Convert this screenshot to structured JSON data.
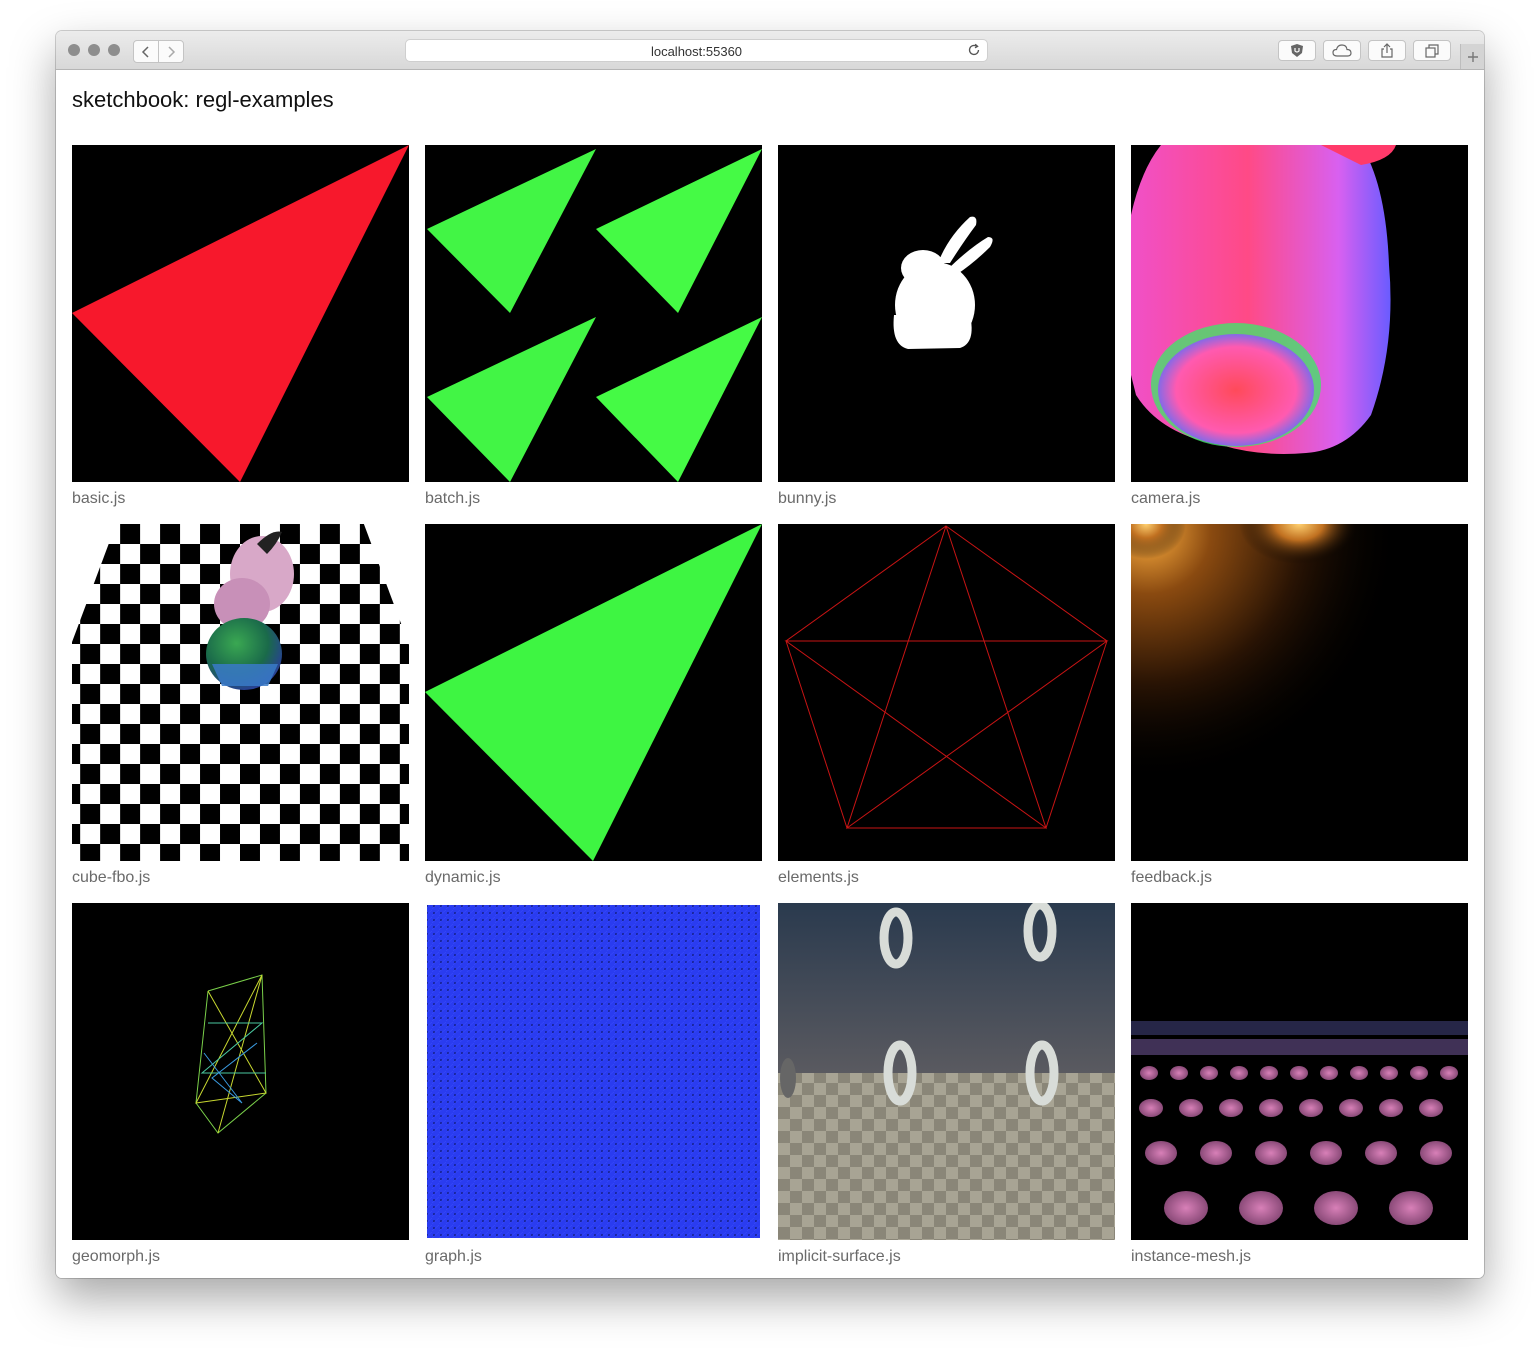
{
  "browser": {
    "url": "localhost:55360"
  },
  "page": {
    "title": "sketchbook: regl-examples"
  },
  "examples": [
    {
      "label": "basic.js"
    },
    {
      "label": "batch.js"
    },
    {
      "label": "bunny.js"
    },
    {
      "label": "camera.js"
    },
    {
      "label": "cube-fbo.js"
    },
    {
      "label": "dynamic.js"
    },
    {
      "label": "elements.js"
    },
    {
      "label": "feedback.js"
    },
    {
      "label": "geomorph.js"
    },
    {
      "label": "graph.js"
    },
    {
      "label": "implicit-surface.js"
    },
    {
      "label": "instance-mesh.js"
    }
  ],
  "icons": {
    "back": "chevron-left-icon",
    "forward": "chevron-right-icon",
    "reload": "reload-icon",
    "shield": "shield-icon",
    "cloud": "cloud-icon",
    "share": "share-icon",
    "tabs": "tabs-icon",
    "newtab": "plus-icon"
  },
  "colors": {
    "red_triangle": "#f7182c",
    "green_triangle": "#45fa45",
    "graph_blue": "#2a3cf0",
    "pentagon_red": "#c81414"
  }
}
